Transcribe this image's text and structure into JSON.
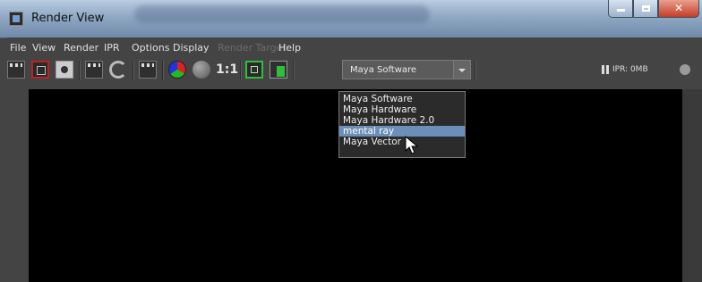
{
  "window": {
    "title": "Render View"
  },
  "menubar": {
    "items": [
      {
        "label": "File",
        "enabled": true
      },
      {
        "label": "View",
        "enabled": true
      },
      {
        "label": "Render",
        "enabled": true
      },
      {
        "label": "IPR",
        "enabled": true
      },
      {
        "label": "Options",
        "enabled": true
      },
      {
        "label": "Display",
        "enabled": true
      },
      {
        "label": "Render Target",
        "enabled": false
      },
      {
        "label": "Help",
        "enabled": true
      }
    ]
  },
  "toolbar": {
    "ratio_label": "1:1",
    "renderer": {
      "selected": "Maya Software"
    },
    "ipr_status": "IPR: 0MB"
  },
  "renderer_dropdown": {
    "options": [
      "Maya Software",
      "Maya Hardware",
      "Maya Hardware 2.0",
      "mental ray",
      "Maya Vector"
    ],
    "highlighted": "mental ray"
  },
  "colors": {
    "highlight": "#6c8fb9",
    "accent_green": "#2fbf3a",
    "accent_red": "#c02020"
  }
}
